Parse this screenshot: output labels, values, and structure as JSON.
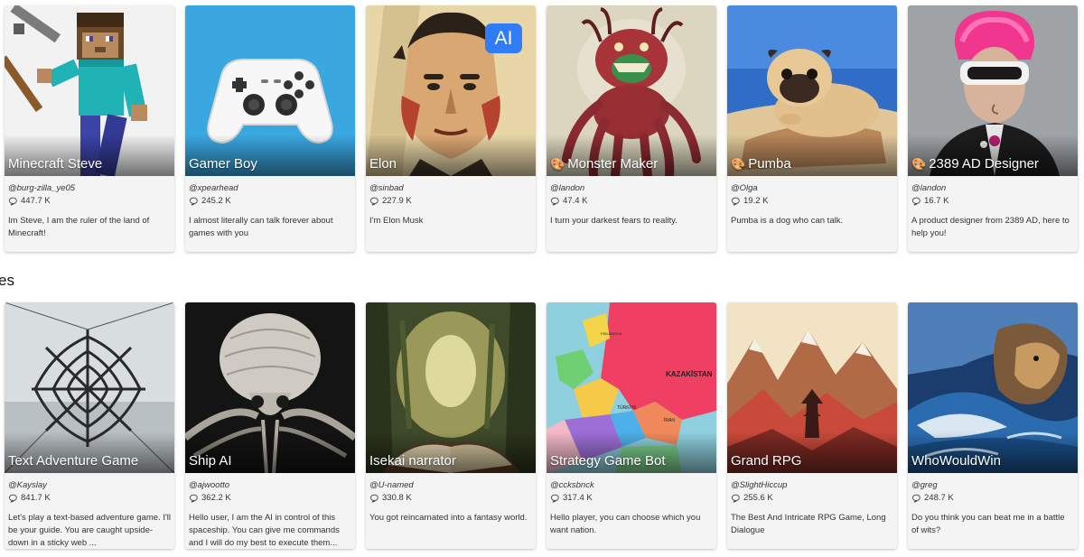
{
  "section": {
    "heading": "es"
  },
  "icons": {
    "chat": "chat-bubble-icon",
    "art": "palette-icon"
  },
  "colors": {
    "ai_badge": "#2f7cf6",
    "card_bg": "#f4f4f4"
  },
  "row1": [
    {
      "name": "Minecraft Steve",
      "creator": "@burg-zilla_ye05",
      "chats": "447.7 K",
      "description": "Im Steve, I am the ruler of the land of Minecraft!"
    },
    {
      "name": "Gamer Boy",
      "creator": "@xpearhead",
      "chats": "245.2 K",
      "description": "I almost literally can talk forever about games with you"
    },
    {
      "name": "Elon",
      "creator": "@sinbad",
      "chats": "227.9 K",
      "description": "I'm Elon Musk",
      "badge": "AI"
    },
    {
      "name": "Monster Maker",
      "creator": "@landon",
      "chats": "47.4 K",
      "description": "I turn your darkest fears to reality.",
      "emoji": "🎨"
    },
    {
      "name": "Pumba",
      "creator": "@Olga",
      "chats": "19.2 K",
      "description": "Pumba is a dog who can talk.",
      "emoji": "🎨"
    },
    {
      "name": "2389 AD Designer",
      "creator": "@landon",
      "chats": "16.7 K",
      "description": "A product designer from 2389 AD, here to help you!",
      "emoji": "🎨"
    }
  ],
  "row2": [
    {
      "name": "Text Adventure Game",
      "creator": "@Kayslay",
      "chats": "841.7 K",
      "description": "Let's play a text-based adventure game. I'll be your guide. You are caught upside-down in a sticky web ..."
    },
    {
      "name": "Ship AI",
      "creator": "@ajwootto",
      "chats": "362.2 K",
      "description": "Hello user, I am the AI in control of this spaceship. You can give me commands and I will do my best to execute them..."
    },
    {
      "name": "Isekai narrator",
      "creator": "@U-named",
      "chats": "330.8 K",
      "description": "You got reincarnated into a fantasy world."
    },
    {
      "name": "Strategy Game Bot",
      "creator": "@ccksbnck",
      "chats": "317.4 K",
      "description": "Hello player, you can choose which you want nation."
    },
    {
      "name": "Grand RPG",
      "creator": "@SlightHiccup",
      "chats": "255.6 K",
      "description": "The Best And Intricate RPG Game, Long Dialogue"
    },
    {
      "name": "WhoWouldWin",
      "creator": "@greg",
      "chats": "248.7 K",
      "description": "Do you think you can beat me in a battle of wits?"
    }
  ],
  "map_labels": {
    "kazakhstan": "KAZAKİSTAN",
    "turkey": "TÜRKİYE",
    "iran": "İRAN",
    "finland": "FİNLANDİYA"
  }
}
